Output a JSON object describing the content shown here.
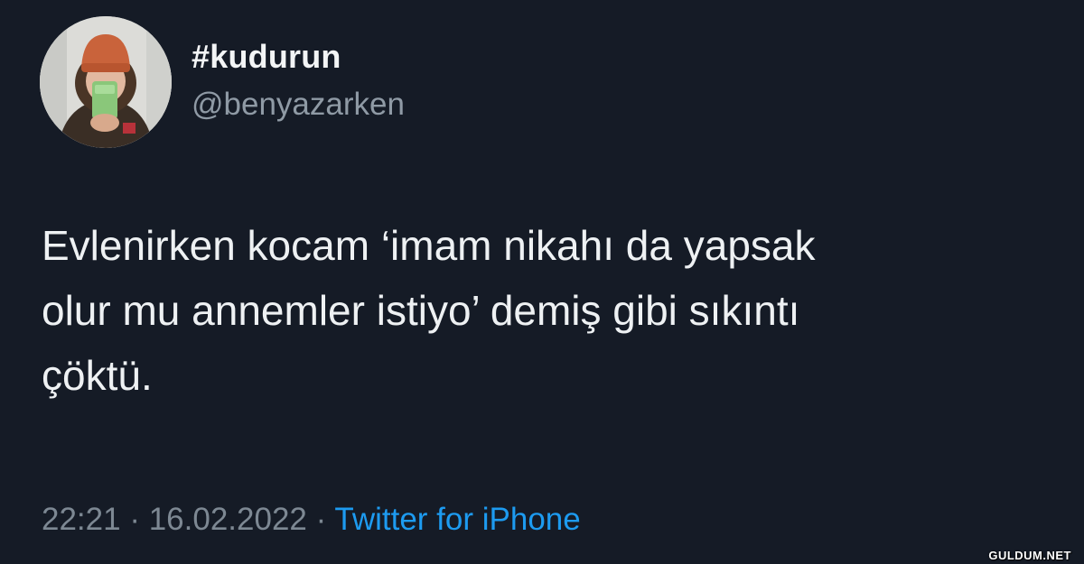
{
  "tweet": {
    "display_name": "#kudurun",
    "handle": "@benyazarken",
    "text_lines": [
      "Evlenirken kocam ‘imam nikahı da yapsak",
      "olur mu annemler istiyo’ demiş gibi sıkıntı",
      "çöktü."
    ],
    "time": "22:21",
    "separator": "·",
    "date": "16.02.2022",
    "source": "Twitter for iPhone"
  },
  "watermark": "GULDUM.NET",
  "colors": {
    "background": "#151b26",
    "primary_text": "#eef1f3",
    "secondary_text": "#7d8893",
    "link": "#1d9bf0"
  }
}
